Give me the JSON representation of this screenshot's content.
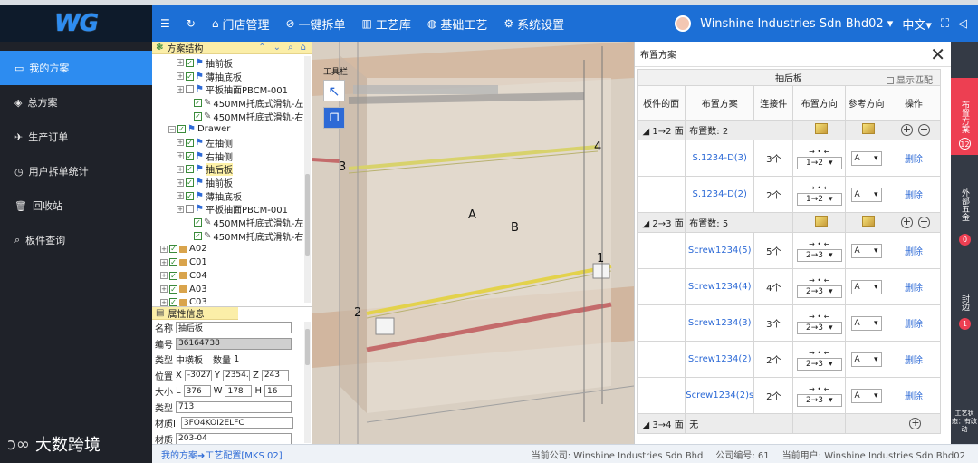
{
  "colors": {
    "topbar": "#1c6fd6",
    "sidebar": "#1f2229",
    "active": "#2d8cf0",
    "panel_header": "#fbeea8",
    "rail": "#343a45",
    "rail_active": "#ed3f52"
  },
  "logo": {
    "text": "WG"
  },
  "nav": {
    "items": [
      {
        "icon": "menu-icon",
        "label": ""
      },
      {
        "icon": "refresh-icon",
        "label": ""
      },
      {
        "icon": "home-icon",
        "label": "门店管理"
      },
      {
        "icon": "check-circle-icon",
        "label": "一键拆单"
      },
      {
        "icon": "library-icon",
        "label": "工艺库"
      },
      {
        "icon": "palette-icon",
        "label": "基础工艺"
      },
      {
        "icon": "gear-icon",
        "label": "系统设置"
      }
    ]
  },
  "topright": {
    "company": "Winshine Industries Sdn Bhd02",
    "language": "中文"
  },
  "sidebar": {
    "items": [
      {
        "icon": "monitor-icon",
        "label": "我的方案"
      },
      {
        "icon": "diamond-icon",
        "label": "总方案"
      },
      {
        "icon": "send-icon",
        "label": "生产订单"
      },
      {
        "icon": "clock-icon",
        "label": "用户拆单统计"
      },
      {
        "icon": "trash-icon",
        "label": "回收站"
      },
      {
        "icon": "search-icon",
        "label": "板件查询"
      }
    ],
    "footer": "大数跨境"
  },
  "tree": {
    "title": "方案结构",
    "rows": [
      {
        "indent": 3,
        "pm": "+",
        "check": true,
        "kind": "flag",
        "label": "抽前板"
      },
      {
        "indent": 3,
        "pm": "+",
        "check": true,
        "kind": "flag",
        "label": "薄抽底板"
      },
      {
        "indent": 3,
        "pm": "+",
        "check": false,
        "kind": "flag",
        "label": "平板抽面PBCM-001"
      },
      {
        "indent": 4,
        "pm": "",
        "check": true,
        "kind": "wrench",
        "label": "450MM托底式滑轨-左"
      },
      {
        "indent": 4,
        "pm": "",
        "check": true,
        "kind": "wrench",
        "label": "450MM托底式滑轨-右"
      },
      {
        "indent": 2,
        "pm": "-",
        "check": true,
        "kind": "flag",
        "label": "Drawer"
      },
      {
        "indent": 3,
        "pm": "+",
        "check": true,
        "kind": "flag",
        "label": "左抽侧"
      },
      {
        "indent": 3,
        "pm": "+",
        "check": true,
        "kind": "flag",
        "label": "右抽侧"
      },
      {
        "indent": 3,
        "pm": "+",
        "check": true,
        "kind": "flag",
        "label": "抽后板",
        "highlight": true
      },
      {
        "indent": 3,
        "pm": "+",
        "check": true,
        "kind": "flag",
        "label": "抽前板"
      },
      {
        "indent": 3,
        "pm": "+",
        "check": true,
        "kind": "flag",
        "label": "薄抽底板"
      },
      {
        "indent": 3,
        "pm": "+",
        "check": false,
        "kind": "flag",
        "label": "平板抽面PBCM-001"
      },
      {
        "indent": 4,
        "pm": "",
        "check": true,
        "kind": "wrench",
        "label": "450MM托底式滑轨-左"
      },
      {
        "indent": 4,
        "pm": "",
        "check": true,
        "kind": "wrench",
        "label": "450MM托底式滑轨-右"
      },
      {
        "indent": 1,
        "pm": "+",
        "check": true,
        "kind": "box",
        "label": "A02"
      },
      {
        "indent": 1,
        "pm": "+",
        "check": true,
        "kind": "box",
        "label": "C01"
      },
      {
        "indent": 1,
        "pm": "+",
        "check": true,
        "kind": "box",
        "label": "C04"
      },
      {
        "indent": 1,
        "pm": "+",
        "check": true,
        "kind": "box",
        "label": "A03"
      },
      {
        "indent": 1,
        "pm": "+",
        "check": true,
        "kind": "box",
        "label": "C03"
      }
    ]
  },
  "props": {
    "title": "属性信息",
    "name_label": "名称",
    "name": "抽后板",
    "id_label": "编号",
    "id": "36164738",
    "type_label": "类型",
    "type": "中横板",
    "qty_label": "数量",
    "qty": "1",
    "pos_label": "位置",
    "pos_x": "-3027",
    "pos_y": "2354.5",
    "pos_z": "243",
    "size_label": "大小",
    "size_l": "376",
    "size_w": "178",
    "size_h": "16",
    "kind_label": "类型",
    "kind": "713",
    "mat1_label": "材质II",
    "mat1": "3FO4KOI2ELFC",
    "mat2_label": "材质",
    "mat2": "203-04"
  },
  "viewport": {
    "toolbar_label": "工具栏",
    "labels": {
      "n1": "1",
      "n2": "2",
      "n3": "3",
      "n4": "4",
      "a": "A",
      "b": "B"
    }
  },
  "layout": {
    "title": "布置方案",
    "board": "抽后板",
    "show_match": "显示匹配",
    "headers": [
      "板件的面",
      "布置方案",
      "连接件",
      "布置方向",
      "参考方向",
      "操作"
    ],
    "groups": [
      {
        "face": "1→2 面",
        "count": "布置数: 2",
        "rows": [
          {
            "plan": "S.1234-D(3)",
            "conn": "3个",
            "dir": "1→2",
            "ref": "A",
            "op": "删除"
          },
          {
            "plan": "S.1234-D(2)",
            "conn": "2个",
            "dir": "1→2",
            "ref": "A",
            "op": "删除"
          }
        ]
      },
      {
        "face": "2→3 面",
        "count": "布置数: 5",
        "rows": [
          {
            "plan": "Screw1234(5)",
            "conn": "5个",
            "dir": "2→3",
            "ref": "A",
            "op": "删除"
          },
          {
            "plan": "Screw1234(4)",
            "conn": "4个",
            "dir": "2→3",
            "ref": "A",
            "op": "删除"
          },
          {
            "plan": "Screw1234(3)",
            "conn": "3个",
            "dir": "2→3",
            "ref": "A",
            "op": "删除"
          },
          {
            "plan": "Screw1234(2)",
            "conn": "2个",
            "dir": "2→3",
            "ref": "A",
            "op": "删除"
          },
          {
            "plan": "Screw1234(2)s",
            "conn": "2个",
            "dir": "2→3",
            "ref": "A",
            "op": "删除"
          }
        ]
      },
      {
        "face": "3→4 面",
        "count": "无",
        "rows": []
      }
    ]
  },
  "rail": {
    "tabs": [
      {
        "label": "布置方案",
        "badge": "12"
      },
      {
        "label": "外部五金",
        "badge": "0"
      },
      {
        "label": "封边",
        "badge": "1"
      },
      {
        "label": "工艺状态：有改动",
        "badge": ""
      }
    ]
  },
  "footer": {
    "crumb": "我的方案➜工艺配置[MKS 02]",
    "company": "当前公司: Winshine Industries Sdn Bhd",
    "company_no": "公司编号: 61",
    "user": "当前用户: Winshine Industries Sdn Bhd02"
  }
}
